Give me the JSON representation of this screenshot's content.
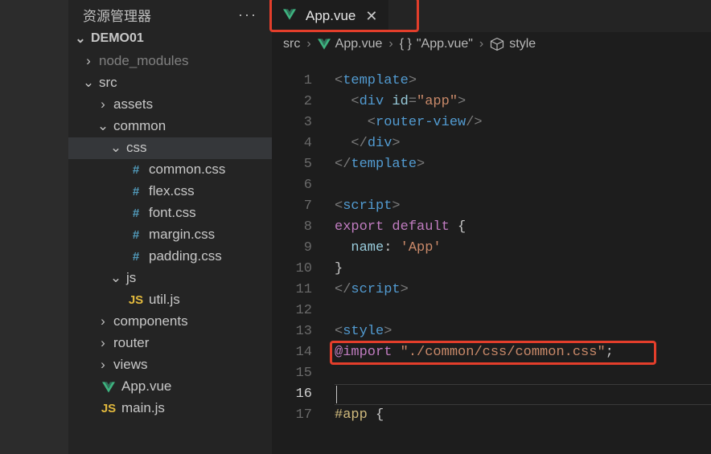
{
  "sidebar": {
    "title": "资源管理器",
    "section": "DEMO01",
    "items": [
      {
        "expanded": null,
        "icon": "",
        "label": "node_modules",
        "indent": 18,
        "dim": true,
        "chev": "›"
      },
      {
        "expanded": true,
        "icon": "",
        "label": "src",
        "indent": 18,
        "chev": "⌄"
      },
      {
        "expanded": null,
        "icon": "",
        "label": "assets",
        "indent": 36,
        "chev": "›"
      },
      {
        "expanded": true,
        "icon": "",
        "label": "common",
        "indent": 36,
        "chev": "⌄"
      },
      {
        "expanded": true,
        "icon": "",
        "label": "css",
        "indent": 52,
        "chev": "⌄",
        "selected": true
      },
      {
        "expanded": null,
        "icon": "css",
        "label": "common.css",
        "indent": 74
      },
      {
        "expanded": null,
        "icon": "css",
        "label": "flex.css",
        "indent": 74
      },
      {
        "expanded": null,
        "icon": "css",
        "label": "font.css",
        "indent": 74
      },
      {
        "expanded": null,
        "icon": "css",
        "label": "margin.css",
        "indent": 74
      },
      {
        "expanded": null,
        "icon": "css",
        "label": "padding.css",
        "indent": 74
      },
      {
        "expanded": true,
        "icon": "",
        "label": "js",
        "indent": 52,
        "chev": "⌄"
      },
      {
        "expanded": null,
        "icon": "js",
        "label": "util.js",
        "indent": 74
      },
      {
        "expanded": null,
        "icon": "",
        "label": "components",
        "indent": 36,
        "chev": "›"
      },
      {
        "expanded": null,
        "icon": "",
        "label": "router",
        "indent": 36,
        "chev": "›"
      },
      {
        "expanded": null,
        "icon": "",
        "label": "views",
        "indent": 36,
        "chev": "›"
      },
      {
        "expanded": null,
        "icon": "vue",
        "label": "App.vue",
        "indent": 40
      },
      {
        "expanded": null,
        "icon": "js",
        "label": "main.js",
        "indent": 40
      }
    ]
  },
  "tab": {
    "filename": "App.vue"
  },
  "breadcrumbs": {
    "p0": "src",
    "p1": "App.vue",
    "p2": "\"App.vue\"",
    "p3": "style"
  },
  "code": {
    "lines": {
      "l1": {
        "a": "<",
        "b": "template",
        "c": ">"
      },
      "l2": {
        "a": "  <",
        "b": "div",
        "c": " ",
        "d": "id",
        "e": "=",
        "f": "\"app\"",
        "g": ">"
      },
      "l3": {
        "a": "    <",
        "b": "router-view",
        "c": "/>"
      },
      "l4": {
        "a": "  </",
        "b": "div",
        "c": ">"
      },
      "l5": {
        "a": "</",
        "b": "template",
        "c": ">"
      },
      "l7": {
        "a": "<",
        "b": "script",
        "c": ">"
      },
      "l8": {
        "a": "export",
        "b": " ",
        "c": "default",
        "d": " {"
      },
      "l9": {
        "a": "  ",
        "b": "name",
        "c": ": ",
        "d": "'App'"
      },
      "l10": {
        "a": "}"
      },
      "l11": {
        "a": "</",
        "b": "script",
        "c": ">"
      },
      "l13": {
        "a": "<",
        "b": "style",
        "c": ">"
      },
      "l14": {
        "a": "@import",
        "b": " ",
        "c": "\"./common/css/common.css\"",
        "d": ";"
      },
      "l17": {
        "a": "#app",
        "b": " {"
      }
    },
    "current_line": 16
  }
}
